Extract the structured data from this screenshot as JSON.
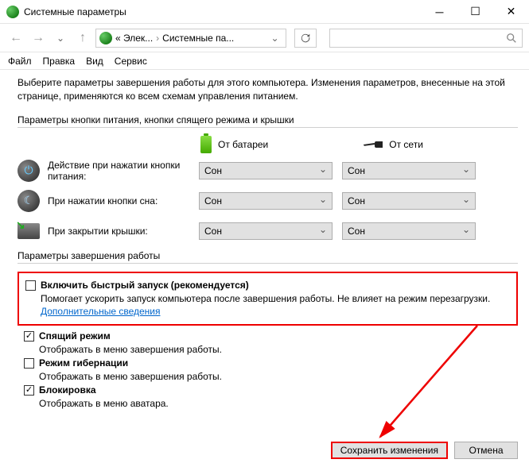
{
  "window": {
    "title": "Системные параметры"
  },
  "breadcrumb": {
    "part1": "« Элек...",
    "part2": "Системные па..."
  },
  "menu": {
    "file": "Файл",
    "edit": "Правка",
    "view": "Вид",
    "service": "Сервис"
  },
  "intro": "Выберите параметры завершения работы для этого компьютера. Изменения параметров, внесенные на этой странице, применяются ко всем схемам управления питанием.",
  "group1": {
    "header": "Параметры кнопки питания, кнопки спящего режима и крышки",
    "col_battery": "От батареи",
    "col_ac": "От сети",
    "rows": [
      {
        "label": "Действие при нажатии кнопки питания:",
        "battery": "Сон",
        "ac": "Сон"
      },
      {
        "label": "При нажатии кнопки сна:",
        "battery": "Сон",
        "ac": "Сон"
      },
      {
        "label": "При закрытии крышки:",
        "battery": "Сон",
        "ac": "Сон"
      }
    ]
  },
  "group2": {
    "header": "Параметры завершения работы",
    "items": [
      {
        "checked": false,
        "title": "Включить быстрый запуск (рекомендуется)",
        "sub": "Помогает ускорить запуск компьютера после завершения работы. Не влияет на режим перезагрузки.",
        "link": "Дополнительные сведения"
      },
      {
        "checked": true,
        "title": "Спящий режим",
        "sub": "Отображать в меню завершения работы."
      },
      {
        "checked": false,
        "title": "Режим гибернации",
        "sub": "Отображать в меню завершения работы."
      },
      {
        "checked": true,
        "title": "Блокировка",
        "sub": "Отображать в меню аватара."
      }
    ]
  },
  "buttons": {
    "save": "Сохранить изменения",
    "cancel": "Отмена"
  }
}
